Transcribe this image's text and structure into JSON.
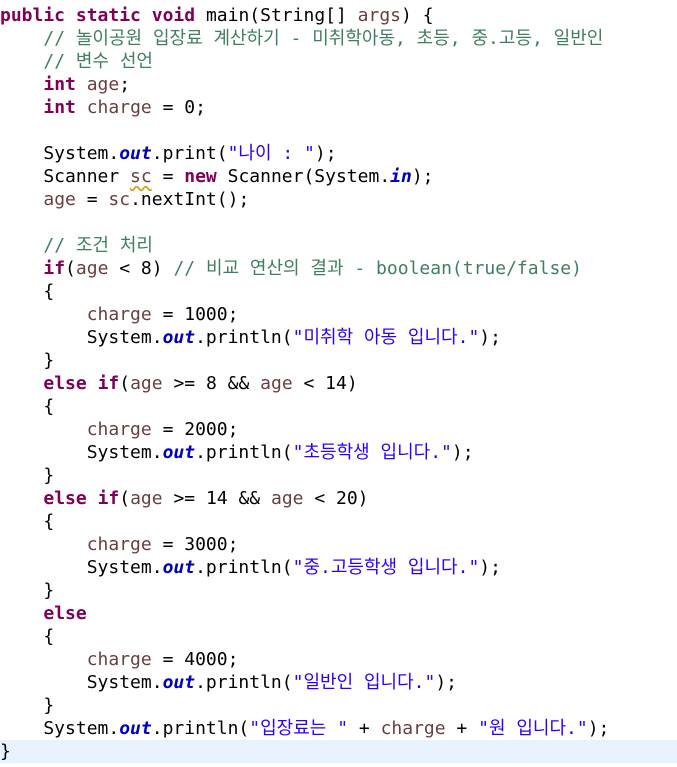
{
  "editor": {
    "lines": [
      [
        [
          "kw",
          "public"
        ],
        [
          "pl",
          " "
        ],
        [
          "kw",
          "static"
        ],
        [
          "pl",
          " "
        ],
        [
          "kw",
          "void"
        ],
        [
          "pl",
          " main(String[] "
        ],
        [
          "var",
          "args"
        ],
        [
          "pl",
          ") {"
        ]
      ],
      [
        [
          "pl",
          "    "
        ],
        [
          "cm",
          "// 놀이공원 입장료 계산하기 - 미취학아동, 초등, 중.고등, 일반인"
        ]
      ],
      [
        [
          "pl",
          "    "
        ],
        [
          "cm",
          "// 변수 선언"
        ]
      ],
      [
        [
          "pl",
          "    "
        ],
        [
          "kw",
          "int"
        ],
        [
          "pl",
          " "
        ],
        [
          "var",
          "age"
        ],
        [
          "pl",
          ";"
        ]
      ],
      [
        [
          "pl",
          "    "
        ],
        [
          "kw",
          "int"
        ],
        [
          "pl",
          " "
        ],
        [
          "var",
          "charge"
        ],
        [
          "pl",
          " = 0;"
        ]
      ],
      [
        [
          "pl",
          ""
        ]
      ],
      [
        [
          "pl",
          "    System."
        ],
        [
          "fld",
          "out"
        ],
        [
          "pl",
          ".print("
        ],
        [
          "str",
          "\"나이 : \""
        ],
        [
          "pl",
          ");"
        ]
      ],
      [
        [
          "pl",
          "    Scanner "
        ],
        [
          "var warn",
          "sc"
        ],
        [
          "pl",
          " = "
        ],
        [
          "kw",
          "new"
        ],
        [
          "pl",
          " Scanner(System."
        ],
        [
          "fld",
          "in"
        ],
        [
          "pl",
          ");"
        ]
      ],
      [
        [
          "pl",
          "    "
        ],
        [
          "var",
          "age"
        ],
        [
          "pl",
          " = "
        ],
        [
          "var",
          "sc"
        ],
        [
          "pl",
          ".nextInt();"
        ]
      ],
      [
        [
          "pl",
          ""
        ]
      ],
      [
        [
          "pl",
          "    "
        ],
        [
          "cm",
          "// 조건 처리"
        ]
      ],
      [
        [
          "pl",
          "    "
        ],
        [
          "kw",
          "if"
        ],
        [
          "pl",
          "("
        ],
        [
          "var",
          "age"
        ],
        [
          "pl",
          " < 8) "
        ],
        [
          "cm",
          "// 비교 연산의 결과 - boolean(true/false)"
        ]
      ],
      [
        [
          "pl",
          "    {"
        ]
      ],
      [
        [
          "pl",
          "        "
        ],
        [
          "var",
          "charge"
        ],
        [
          "pl",
          " = 1000;"
        ]
      ],
      [
        [
          "pl",
          "        System."
        ],
        [
          "fld",
          "out"
        ],
        [
          "pl",
          ".println("
        ],
        [
          "str",
          "\"미취학 아동 입니다.\""
        ],
        [
          "pl",
          ");"
        ]
      ],
      [
        [
          "pl",
          "    }"
        ]
      ],
      [
        [
          "pl",
          "    "
        ],
        [
          "kw",
          "else"
        ],
        [
          "pl",
          " "
        ],
        [
          "kw",
          "if"
        ],
        [
          "pl",
          "("
        ],
        [
          "var",
          "age"
        ],
        [
          "pl",
          " >= 8 && "
        ],
        [
          "var",
          "age"
        ],
        [
          "pl",
          " < 14)"
        ]
      ],
      [
        [
          "pl",
          "    {"
        ]
      ],
      [
        [
          "pl",
          "        "
        ],
        [
          "var",
          "charge"
        ],
        [
          "pl",
          " = 2000;"
        ]
      ],
      [
        [
          "pl",
          "        System."
        ],
        [
          "fld",
          "out"
        ],
        [
          "pl",
          ".println("
        ],
        [
          "str",
          "\"초등학생 입니다.\""
        ],
        [
          "pl",
          ");"
        ]
      ],
      [
        [
          "pl",
          "    }"
        ]
      ],
      [
        [
          "pl",
          "    "
        ],
        [
          "kw",
          "else"
        ],
        [
          "pl",
          " "
        ],
        [
          "kw",
          "if"
        ],
        [
          "pl",
          "("
        ],
        [
          "var",
          "age"
        ],
        [
          "pl",
          " >= 14 && "
        ],
        [
          "var",
          "age"
        ],
        [
          "pl",
          " < 20)"
        ]
      ],
      [
        [
          "pl",
          "    {"
        ]
      ],
      [
        [
          "pl",
          "        "
        ],
        [
          "var",
          "charge"
        ],
        [
          "pl",
          " = 3000;"
        ]
      ],
      [
        [
          "pl",
          "        System."
        ],
        [
          "fld",
          "out"
        ],
        [
          "pl",
          ".println("
        ],
        [
          "str",
          "\"중.고등학생 입니다.\""
        ],
        [
          "pl",
          ");"
        ]
      ],
      [
        [
          "pl",
          "    }"
        ]
      ],
      [
        [
          "pl",
          "    "
        ],
        [
          "kw",
          "else"
        ]
      ],
      [
        [
          "pl",
          "    {"
        ]
      ],
      [
        [
          "pl",
          "        "
        ],
        [
          "var",
          "charge"
        ],
        [
          "pl",
          " = 4000;"
        ]
      ],
      [
        [
          "pl",
          "        System."
        ],
        [
          "fld",
          "out"
        ],
        [
          "pl",
          ".println("
        ],
        [
          "str",
          "\"일반인 입니다.\""
        ],
        [
          "pl",
          ");"
        ]
      ],
      [
        [
          "pl",
          "    }"
        ]
      ],
      [
        [
          "pl",
          "    System."
        ],
        [
          "fld",
          "out"
        ],
        [
          "pl",
          ".println("
        ],
        [
          "str",
          "\"입장료는 \""
        ],
        [
          "pl",
          " + "
        ],
        [
          "var",
          "charge"
        ],
        [
          "pl",
          " + "
        ],
        [
          "str",
          "\"원 입니다.\""
        ],
        [
          "pl",
          ");"
        ]
      ],
      [
        [
          "pl",
          "}"
        ]
      ]
    ],
    "current_line_index": 32
  },
  "colors": {
    "keyword": "#7f0055",
    "comment": "#3f7f5f",
    "string": "#2a00ff",
    "local_variable": "#6a3e3e",
    "static_field": "#0000c0",
    "current_line_highlight": "#e8f2fe",
    "warning_underline": "#d4a017"
  }
}
